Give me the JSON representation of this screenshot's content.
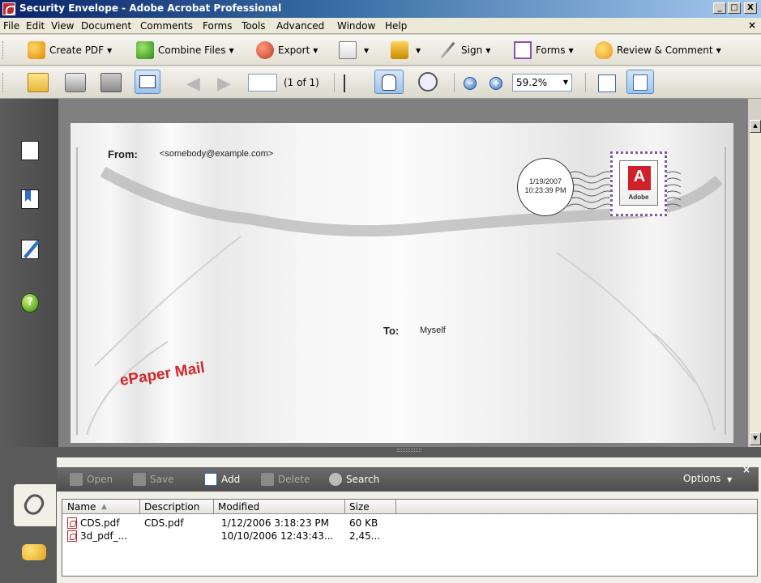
{
  "window": {
    "title": "Security Envelope - Adobe Acrobat Professional",
    "buttons": [
      "_",
      "□",
      "X"
    ]
  },
  "menu": {
    "items": [
      "File",
      "Edit",
      "View",
      "Document",
      "Comments",
      "Forms",
      "Tools",
      "Advanced",
      "Window",
      "Help"
    ],
    "close_doc": "×"
  },
  "tasks_toolbar": {
    "create_pdf": "Create PDF",
    "combine_files": "Combine Files",
    "export": "Export",
    "sign": "Sign",
    "forms": "Forms",
    "review_comment": "Review & Comment",
    "dropdown_glyph": "▼"
  },
  "nav_toolbar": {
    "page_input": "",
    "page_of": "(1 of 1)",
    "zoom": "59.2%",
    "zoom_out_glyph": "−",
    "zoom_in_glyph": "+"
  },
  "left_pane": {
    "icons": [
      "pages-icon",
      "bookmarks-icon",
      "signatures-icon",
      "help-icon"
    ],
    "help_glyph": "?"
  },
  "document": {
    "from_label": "From:",
    "from_value": "<somebody@example.com>",
    "to_label": "To:",
    "to_value": "Myself",
    "brand": "ePaper Mail",
    "postmark_date": "1/19/2007",
    "postmark_time": "10:23:39 PM",
    "stamp_text": "Adobe"
  },
  "attachments": {
    "toolbar": {
      "open": "Open",
      "save": "Save",
      "add": "Add",
      "delete": "Delete",
      "search": "Search",
      "options": "Options",
      "close": "×"
    },
    "columns": [
      "Name",
      "Description",
      "Modified",
      "Size"
    ],
    "sort_glyph": "▲",
    "rows": [
      {
        "name": "CDS.pdf",
        "description": "CDS.pdf",
        "modified": "1/12/2006 3:18:23 PM",
        "size": "60 KB"
      },
      {
        "name": "3d_pdf_...",
        "description": "",
        "modified": "10/10/2006 12:43:43...",
        "size": "2,45..."
      }
    ]
  },
  "colors": {
    "title_bar": "#0a246a",
    "brand_red": "#d4272a",
    "stamp_border": "#7d59a6",
    "pane_dark": "#5a5a5a"
  }
}
